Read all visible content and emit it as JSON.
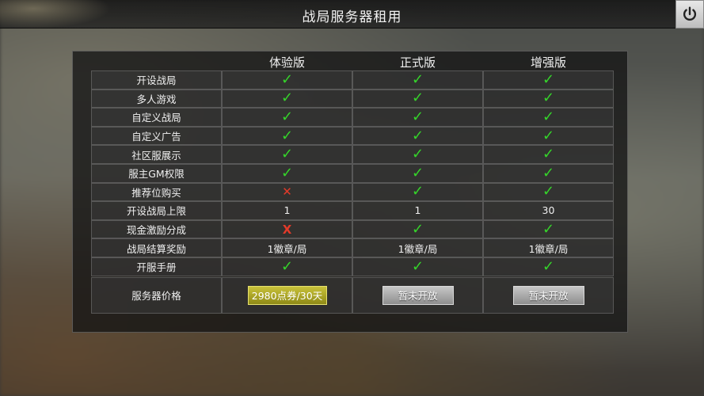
{
  "title": "战局服务器租用",
  "columns": [
    "体验版",
    "正式版",
    "增强版"
  ],
  "rows": [
    {
      "label": "开设战局",
      "values": [
        "check",
        "check",
        "check"
      ]
    },
    {
      "label": "多人游戏",
      "values": [
        "check",
        "check",
        "check"
      ]
    },
    {
      "label": "自定义战局",
      "values": [
        "check",
        "check",
        "check"
      ]
    },
    {
      "label": "自定义广告",
      "values": [
        "check",
        "check",
        "check"
      ]
    },
    {
      "label": "社区服展示",
      "values": [
        "check",
        "check",
        "check"
      ]
    },
    {
      "label": "服主GM权限",
      "values": [
        "check",
        "check",
        "check"
      ]
    },
    {
      "label": "推荐位购买",
      "values": [
        "cross",
        "check",
        "check"
      ]
    },
    {
      "label": "开设战局上限",
      "values": [
        "1",
        "1",
        "30"
      ]
    },
    {
      "label": "现金激励分成",
      "values": [
        "X",
        "check",
        "check"
      ]
    },
    {
      "label": "战局结算奖励",
      "values": [
        "1徽章/局",
        "1徽章/局",
        "1徽章/局"
      ]
    },
    {
      "label": "开服手册",
      "values": [
        "check",
        "check",
        "check"
      ]
    }
  ],
  "price": {
    "label": "服务器价格",
    "buttons": [
      "2980点券/30天",
      "暂未开放",
      "暂未开放"
    ]
  },
  "icons": {
    "power": "power-icon",
    "check": "check-icon",
    "cross": "cross-icon"
  },
  "colors": {
    "check": "#35d42a",
    "cross": "#e23a2a",
    "gold_button": "#b0a92a"
  }
}
